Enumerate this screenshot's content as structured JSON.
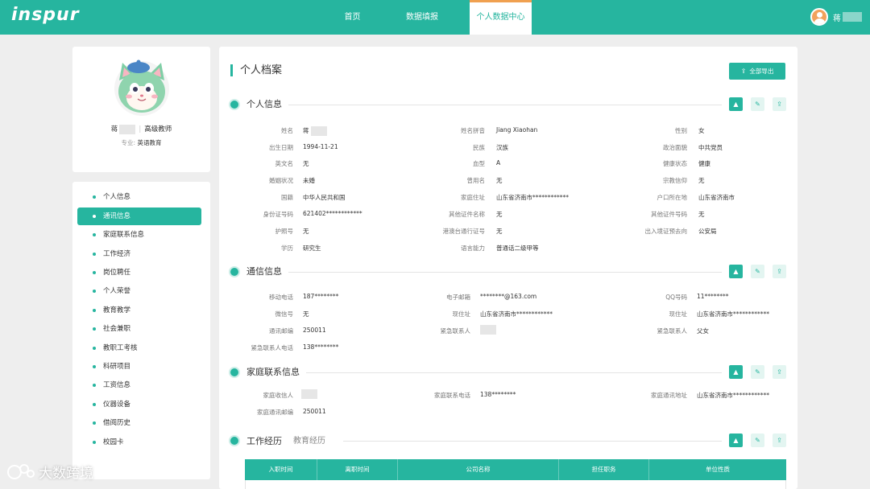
{
  "brand": {
    "logo": "inspur",
    "accent": "#26b59f",
    "tab_indicator": "#f0a050"
  },
  "nav": {
    "items": [
      "首页",
      "数据填报",
      "个人数据中心"
    ],
    "active_index": 2
  },
  "user": {
    "name": "蒋"
  },
  "profile": {
    "name": "蒋",
    "title": "高级教师",
    "major_label": "专业:",
    "major_value": "英语教育"
  },
  "menu": {
    "active_index": 1,
    "items": [
      "个人信息",
      "通讯信息",
      "家庭联系信息",
      "工作经济",
      "岗位聘任",
      "个人荣誉",
      "教育教学",
      "社会兼职",
      "教职工考核",
      "科研项目",
      "工资信息",
      "仪器设备",
      "借阅历史",
      "校园卡"
    ]
  },
  "page": {
    "title": "个人档案",
    "export_label": "全部导出",
    "export_icon": "upload-icon"
  },
  "sections": {
    "personal": {
      "title": "个人信息",
      "fields": [
        {
          "label": "姓名",
          "value": "蒋"
        },
        {
          "label": "姓名拼音",
          "value": "Jiang Xiaohan"
        },
        {
          "label": "性别",
          "value": "女"
        },
        {
          "label": "出生日期",
          "value": "1994-11-21"
        },
        {
          "label": "民族",
          "value": "汉族"
        },
        {
          "label": "政治面貌",
          "value": "中共党员"
        },
        {
          "label": "英文名",
          "value": "无"
        },
        {
          "label": "血型",
          "value": "A"
        },
        {
          "label": "健康状态",
          "value": "健康"
        },
        {
          "label": "婚姻状况",
          "value": "未婚"
        },
        {
          "label": "曾用名",
          "value": "无"
        },
        {
          "label": "宗教信仰",
          "value": "无"
        },
        {
          "label": "国籍",
          "value": "中华人民共和国"
        },
        {
          "label": "家庭住址",
          "value": "山东省济南市************"
        },
        {
          "label": "户口所在地",
          "value": "山东省济南市"
        },
        {
          "label": "身份证号码",
          "value": "621402************"
        },
        {
          "label": "其他证件名称",
          "value": "无"
        },
        {
          "label": "其他证件号码",
          "value": "无"
        },
        {
          "label": "护照号",
          "value": "无"
        },
        {
          "label": "港澳台通行证号",
          "value": "无"
        },
        {
          "label": "出入境证预去向",
          "value": "公安局"
        },
        {
          "label": "学历",
          "value": "研究生"
        },
        {
          "label": "语言能力",
          "value": "普通话二级甲等"
        }
      ]
    },
    "contact": {
      "title": "通信信息",
      "fields": [
        {
          "label": "移动电话",
          "value": "187********"
        },
        {
          "label": "电子邮箱",
          "value": "********@163.com"
        },
        {
          "label": "QQ号码",
          "value": "11********"
        },
        {
          "label": "微信号",
          "value": "无"
        },
        {
          "label": "现住址",
          "value": "山东省济南市************"
        },
        {
          "label": "现住址",
          "value": "山东省济南市************"
        },
        {
          "label": "通讯邮编",
          "value": "250011"
        },
        {
          "label": "紧急联系人",
          "value": ""
        },
        {
          "label": "紧急联系人",
          "value": "父女"
        },
        {
          "label": "紧急联系人电话",
          "value": "138********"
        }
      ]
    },
    "family": {
      "title": "家庭联系信息",
      "fields": [
        {
          "label": "家庭收信人",
          "value": ""
        },
        {
          "label": "家庭联系电话",
          "value": "138********"
        },
        {
          "label": "家庭通讯地址",
          "value": "山东省济南市************"
        },
        {
          "label": "家庭通讯邮编",
          "value": "250011"
        }
      ]
    }
  },
  "work": {
    "tabs": [
      "工作经历",
      "教育经历"
    ],
    "active_tab": 0,
    "columns": [
      "入职时间",
      "离职时间",
      "公司名称",
      "担任职务",
      "单位性质"
    ]
  },
  "watermark": {
    "text": "大数跨境"
  }
}
